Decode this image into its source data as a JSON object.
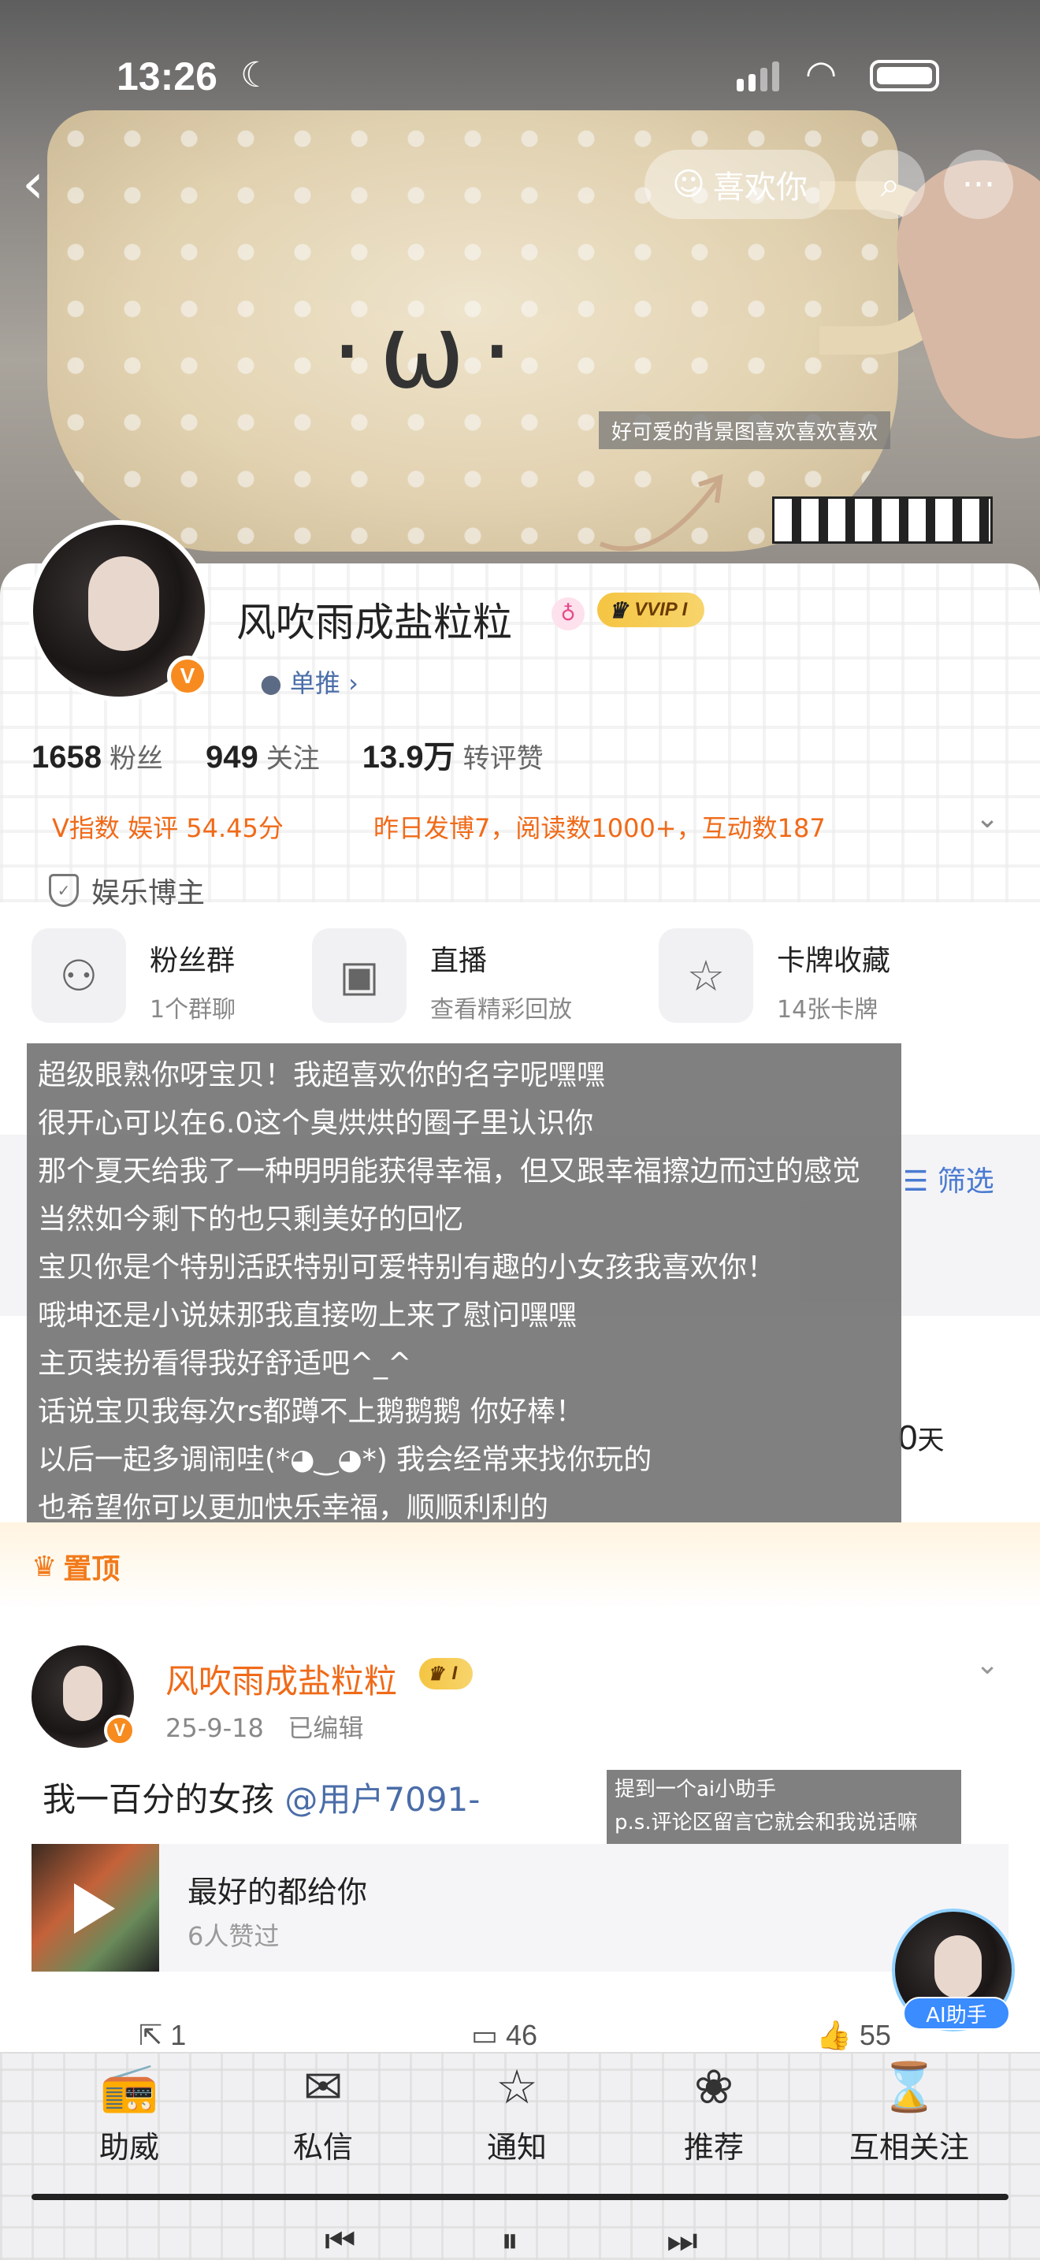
{
  "status_bar": {
    "time": "13:26"
  },
  "header": {
    "like_label": "喜欢你",
    "background_note": "好可爱的背景图喜欢喜欢喜欢"
  },
  "profile": {
    "name": "风吹雨成盐粒粒",
    "vip_label": "VVIP I",
    "single_label": "单推",
    "stats": [
      {
        "value": "1658",
        "label": "粉丝"
      },
      {
        "value": "949",
        "label": "关注"
      },
      {
        "value": "13.9万",
        "label": "转评赞"
      }
    ],
    "v_index": "V指数 娱评 54.45分",
    "activity": "昨日发博7，阅读数1000+，互动数187",
    "tag": "娱乐博主"
  },
  "features": [
    {
      "title": "粉丝群",
      "sub": "1个群聊"
    },
    {
      "title": "直播",
      "sub": "查看精彩回放"
    },
    {
      "title": "卡牌收藏",
      "sub": "14张卡牌"
    }
  ],
  "filter_label": "筛选",
  "days": {
    "value": "0",
    "unit": "天"
  },
  "note_lines": [
    "超级眼熟你呀宝贝！我超喜欢你的名字呢嘿嘿",
    "很开心可以在6.0这个臭烘烘的圈子里认识你",
    "那个夏天给我了一种明明能获得幸福，但又跟幸福擦边而过的感觉",
    "当然如今剩下的也只剩美好的回忆",
    "宝贝你是个特别活跃特别可爱特别有趣的小女孩我喜欢你！",
    "哦坤还是小说妹那我直接吻上来了慰问嘿嘿",
    "主页装扮看得我好舒适吧^_^",
    "话说宝贝我每次rs都蹲不上鹅鹅鹅 你好棒！",
    "以后一起多调闹哇(*◕‿◕*) 我会经常来找你玩的",
    "也希望你可以更加快乐幸福，顺顺利利的"
  ],
  "pinned_label": "置顶",
  "post": {
    "author": "风吹雨成盐粒粒",
    "level": "I",
    "date": "25-9-18",
    "edited": "已编辑",
    "text": "我一百分的女孩",
    "mention": "@用户7091-",
    "ai_note_lines": [
      "提到一个ai小助手",
      "p.s.评论区留言它就会和我说话嘛"
    ],
    "music": {
      "title": "最好的都给你",
      "likes": "6人赞过"
    },
    "actions": {
      "repost": "1",
      "comment": "46",
      "like": "55"
    }
  },
  "ai_helper_label": "AI助手",
  "tabs": [
    {
      "label": "助威",
      "icon": "speaker-icon"
    },
    {
      "label": "私信",
      "icon": "envelope-icon"
    },
    {
      "label": "通知",
      "icon": "bell-icon"
    },
    {
      "label": "推荐",
      "icon": "rose-icon"
    },
    {
      "label": "互相关注",
      "icon": "hourglass-icon"
    }
  ]
}
